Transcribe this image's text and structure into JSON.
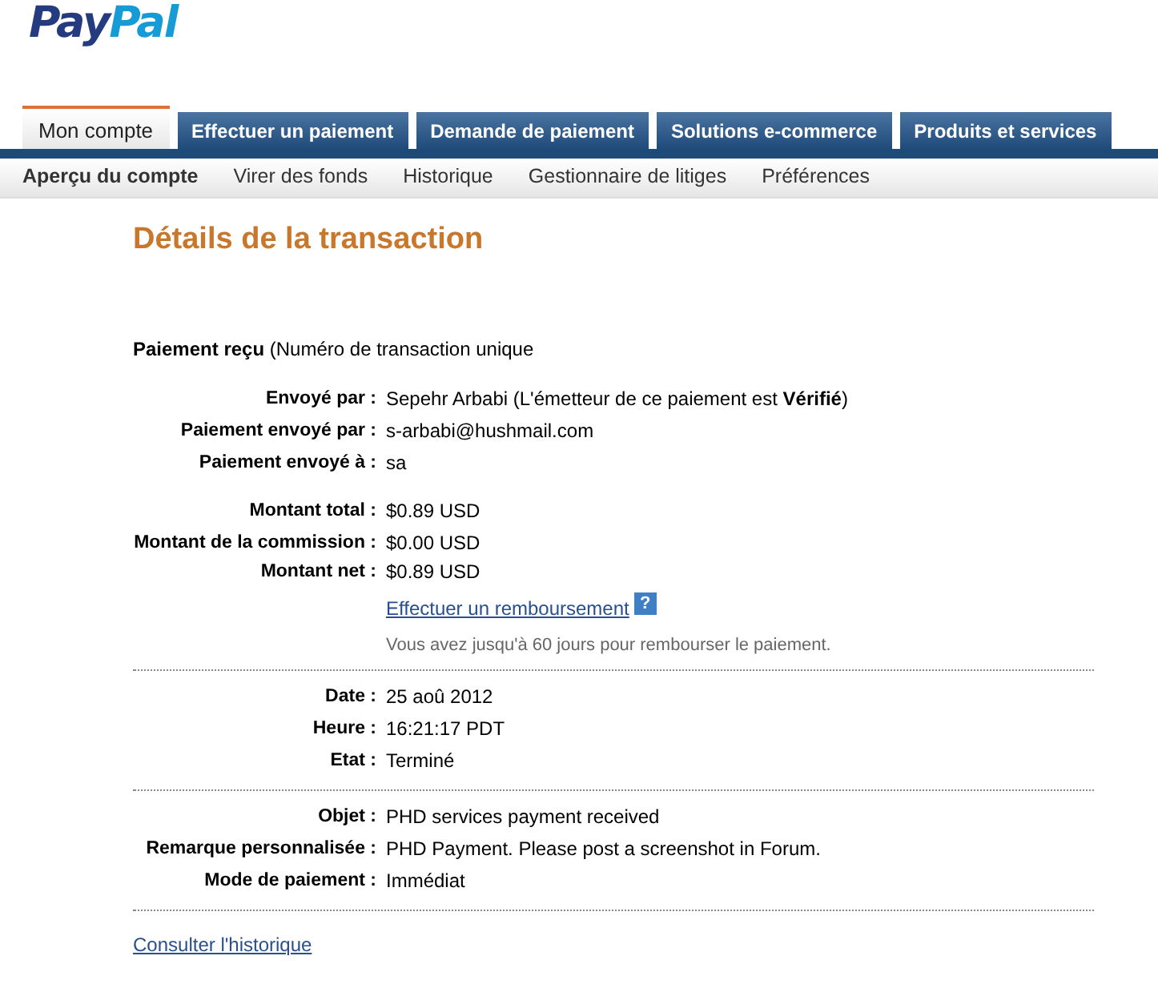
{
  "logo": {
    "first": "Pay",
    "second": "Pal"
  },
  "tabs": [
    {
      "label": "Mon compte",
      "selected": true
    },
    {
      "label": "Effectuer un paiement",
      "selected": false
    },
    {
      "label": "Demande de paiement",
      "selected": false
    },
    {
      "label": "Solutions e-commerce",
      "selected": false
    },
    {
      "label": "Produits et services",
      "selected": false
    }
  ],
  "subnav": [
    {
      "label": "Aperçu du compte",
      "selected": true
    },
    {
      "label": "Virer des fonds",
      "selected": false
    },
    {
      "label": "Historique",
      "selected": false
    },
    {
      "label": "Gestionnaire de litiges",
      "selected": false
    },
    {
      "label": "Préférences",
      "selected": false
    }
  ],
  "title": "Détails de la transaction",
  "summary": "**Paiement reçu** (Numéro de transaction unique",
  "sections": [
    {
      "groups": [
        [
          {
            "kind": "field",
            "label": "Envoyé par :",
            "value": "Sepehr Arbabi (L'émetteur de ce paiement est **Vérifié**)"
          },
          {
            "kind": "field",
            "label": "Paiement envoyé par :",
            "value": "s-arbabi@hushmail.com"
          },
          {
            "kind": "field",
            "label": "Paiement envoyé à :",
            "value": "sa"
          }
        ],
        [
          {
            "kind": "field",
            "label": "Montant total :",
            "value": "$0.89 USD"
          },
          {
            "kind": "field",
            "label": "Montant de la commission :",
            "value": "$0.00 USD"
          },
          {
            "kind": "field",
            "label": "Montant net :",
            "value": "$0.89 USD"
          },
          {
            "kind": "link",
            "text": "Effectuer un remboursement",
            "help": "?"
          },
          {
            "kind": "note",
            "text": "Vous avez jusqu'à 60 jours pour rembourser le paiement."
          }
        ]
      ]
    },
    {
      "groups": [
        [
          {
            "kind": "field",
            "label": "Date :",
            "value": "25 aoû 2012"
          },
          {
            "kind": "field",
            "label": "Heure :",
            "value": "16:21:17 PDT"
          },
          {
            "kind": "field",
            "label": "Etat :",
            "value": "Terminé"
          }
        ]
      ]
    },
    {
      "groups": [
        [
          {
            "kind": "field",
            "label": "Objet :",
            "value": "PHD services payment received"
          },
          {
            "kind": "field",
            "label": "Remarque personnalisée :",
            "value": "PHD Payment. Please post a screenshot in Forum."
          },
          {
            "kind": "field",
            "label": "Mode de paiement :",
            "value": "Immédiat"
          }
        ]
      ]
    }
  ],
  "history_link": "Consulter l'historique"
}
